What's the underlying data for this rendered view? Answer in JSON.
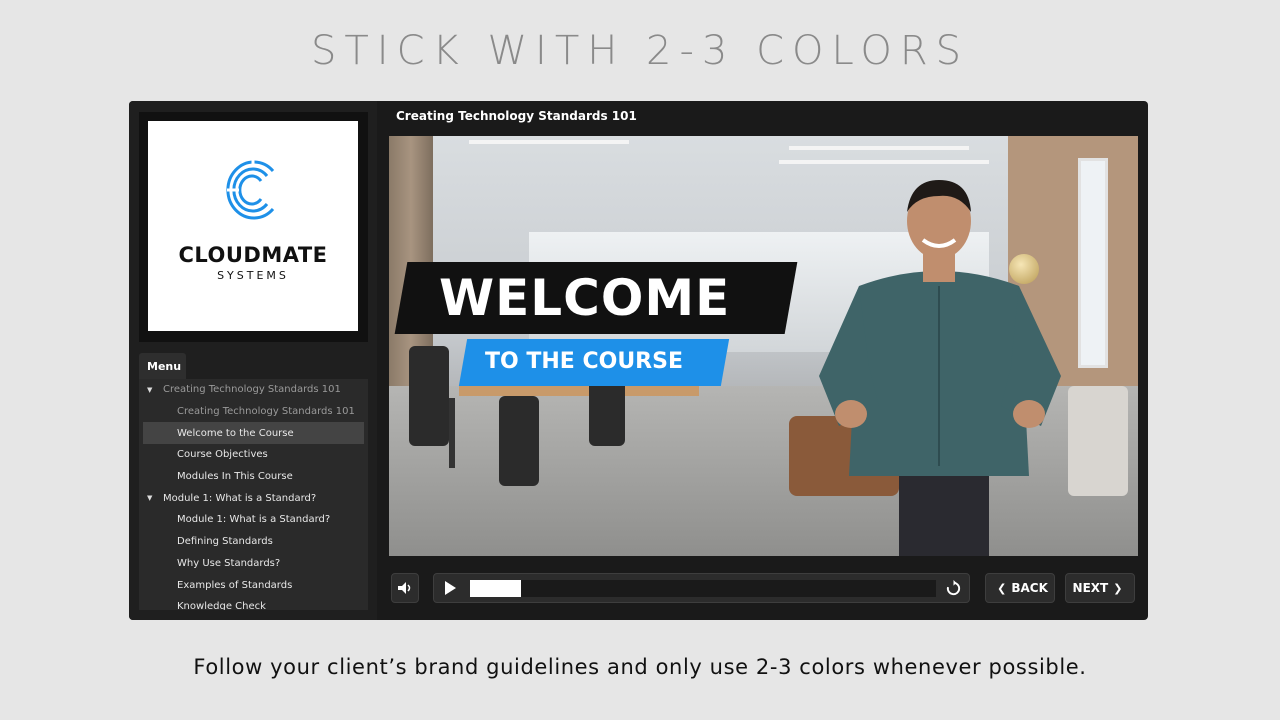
{
  "slide": {
    "headline": "STICK WITH 2-3 COLORS",
    "caption": "Follow your client’s brand guidelines and only use 2-3 colors whenever possible."
  },
  "logo": {
    "name": "CLOUDMATE",
    "sub": "SYSTEMS",
    "accent_color": "#1e90e8"
  },
  "menu": {
    "tab_label": "Menu",
    "items": [
      {
        "label": "Creating Technology Standards 101",
        "level": "parent"
      },
      {
        "label": "Creating Technology Standards 101",
        "level": "child"
      },
      {
        "label": "Welcome to the Course",
        "level": "child",
        "active": true
      },
      {
        "label": "Course Objectives",
        "level": "child"
      },
      {
        "label": "Modules In This Course",
        "level": "child"
      },
      {
        "label": "Module 1: What is a Standard?",
        "level": "parent"
      },
      {
        "label": "Module 1: What is a Standard?",
        "level": "child"
      },
      {
        "label": "Defining Standards",
        "level": "child"
      },
      {
        "label": "Why Use Standards?",
        "level": "child"
      },
      {
        "label": "Examples of Standards",
        "level": "child"
      },
      {
        "label": "Knowledge Check",
        "level": "child"
      }
    ]
  },
  "player": {
    "course_title": "Creating Technology Standards 101",
    "welcome_title": "WELCOME",
    "welcome_subtitle": "TO THE COURSE",
    "progress_fraction": 0.11,
    "back_label": "BACK",
    "next_label": "NEXT",
    "icons": {
      "volume": "volume-icon",
      "play": "play-icon",
      "replay": "replay-icon",
      "back": "chevron-left-icon",
      "next": "chevron-right-icon"
    }
  }
}
